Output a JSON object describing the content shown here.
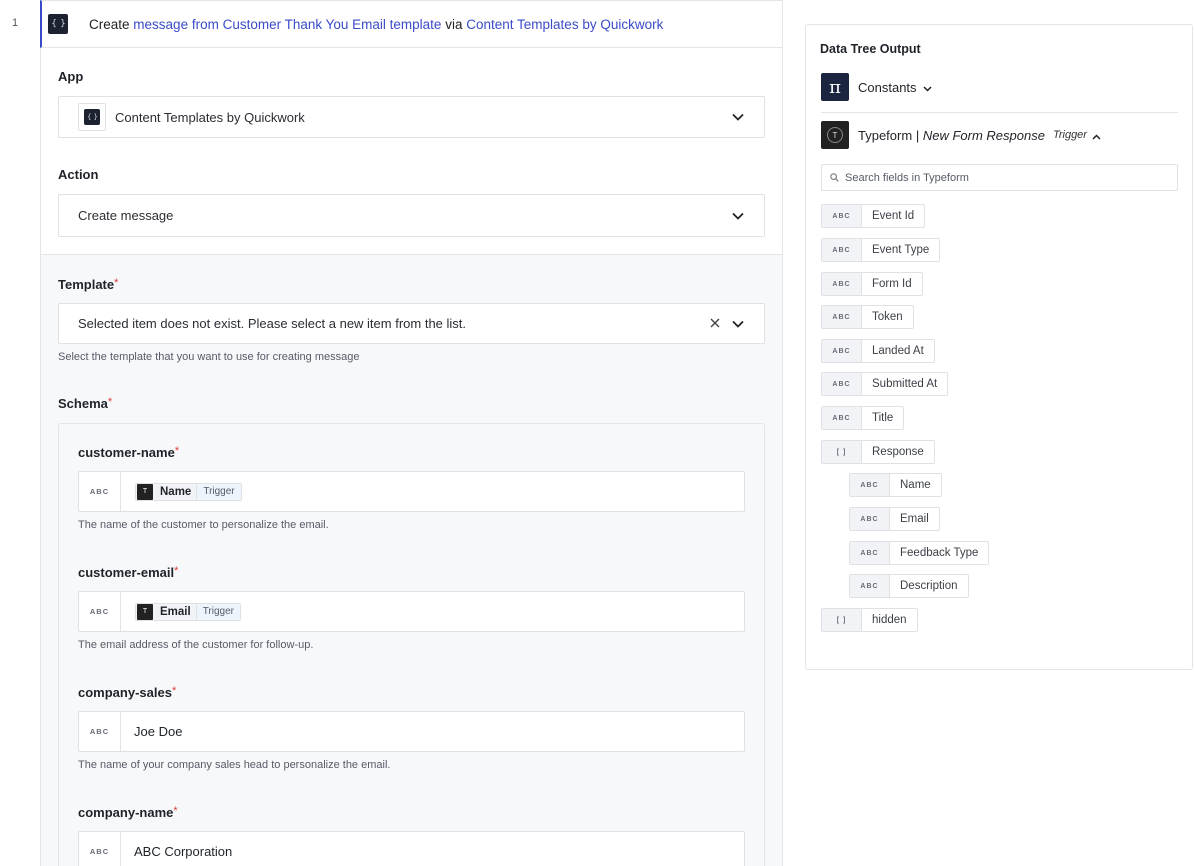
{
  "step": {
    "number": "1",
    "title_prefix": "Create",
    "title_link1": "message from Customer Thank You Email template",
    "title_mid": "via",
    "title_link2": "Content Templates by Quickwork"
  },
  "app": {
    "label": "App",
    "value": "Content Templates by Quickwork"
  },
  "action": {
    "label": "Action",
    "value": "Create message"
  },
  "template": {
    "label": "Template",
    "required_mark": "*",
    "value": "Selected item does not exist. Please select a new item from the list.",
    "hint": "Select the template that you want to use for creating message"
  },
  "schema": {
    "label": "Schema",
    "required_mark": "*",
    "fields": [
      {
        "name": "customer-name",
        "type": "ABC",
        "pill_name": "Name",
        "pill_tag": "Trigger",
        "pill_icon": "T",
        "hint": "The name of the customer to personalize the email."
      },
      {
        "name": "customer-email",
        "type": "ABC",
        "pill_name": "Email",
        "pill_tag": "Trigger",
        "pill_icon": "T",
        "hint": "The email address of the customer for follow-up."
      },
      {
        "name": "company-sales",
        "type": "ABC",
        "value": "Joe Doe",
        "hint": "The name of your company sales head to personalize the email."
      },
      {
        "name": "company-name",
        "type": "ABC",
        "value": "ABC Corporation"
      }
    ]
  },
  "data_tree": {
    "title": "Data Tree Output",
    "constants": {
      "label": "Constants",
      "icon": "π"
    },
    "typeform": {
      "app": "Typeform",
      "separator": "|",
      "event": "New Form Response",
      "tag": "Trigger",
      "icon": "T"
    },
    "search_placeholder": "Search fields in Typeform",
    "fields": [
      {
        "type": "ABC",
        "label": "Event Id"
      },
      {
        "type": "ABC",
        "label": "Event Type"
      },
      {
        "type": "ABC",
        "label": "Form Id"
      },
      {
        "type": "ABC",
        "label": "Token"
      },
      {
        "type": "ABC",
        "label": "Landed At"
      },
      {
        "type": "ABC",
        "label": "Submitted At"
      },
      {
        "type": "ABC",
        "label": "Title"
      },
      {
        "type": "[ ]",
        "label": "Response"
      },
      {
        "type": "ABC",
        "label": "Name"
      },
      {
        "type": "ABC",
        "label": "Email"
      },
      {
        "type": "ABC",
        "label": "Feedback Type"
      },
      {
        "type": "ABC",
        "label": "Description"
      },
      {
        "type": "[ ]",
        "label": "hidden"
      }
    ]
  },
  "icons": {
    "chevron": "chevron-down-icon",
    "clear": "close-icon",
    "search": "search-icon"
  },
  "colors": {
    "accent": "#3b4bc8",
    "required": "#d93a3a",
    "gray_bg": "#f7f8fa"
  }
}
